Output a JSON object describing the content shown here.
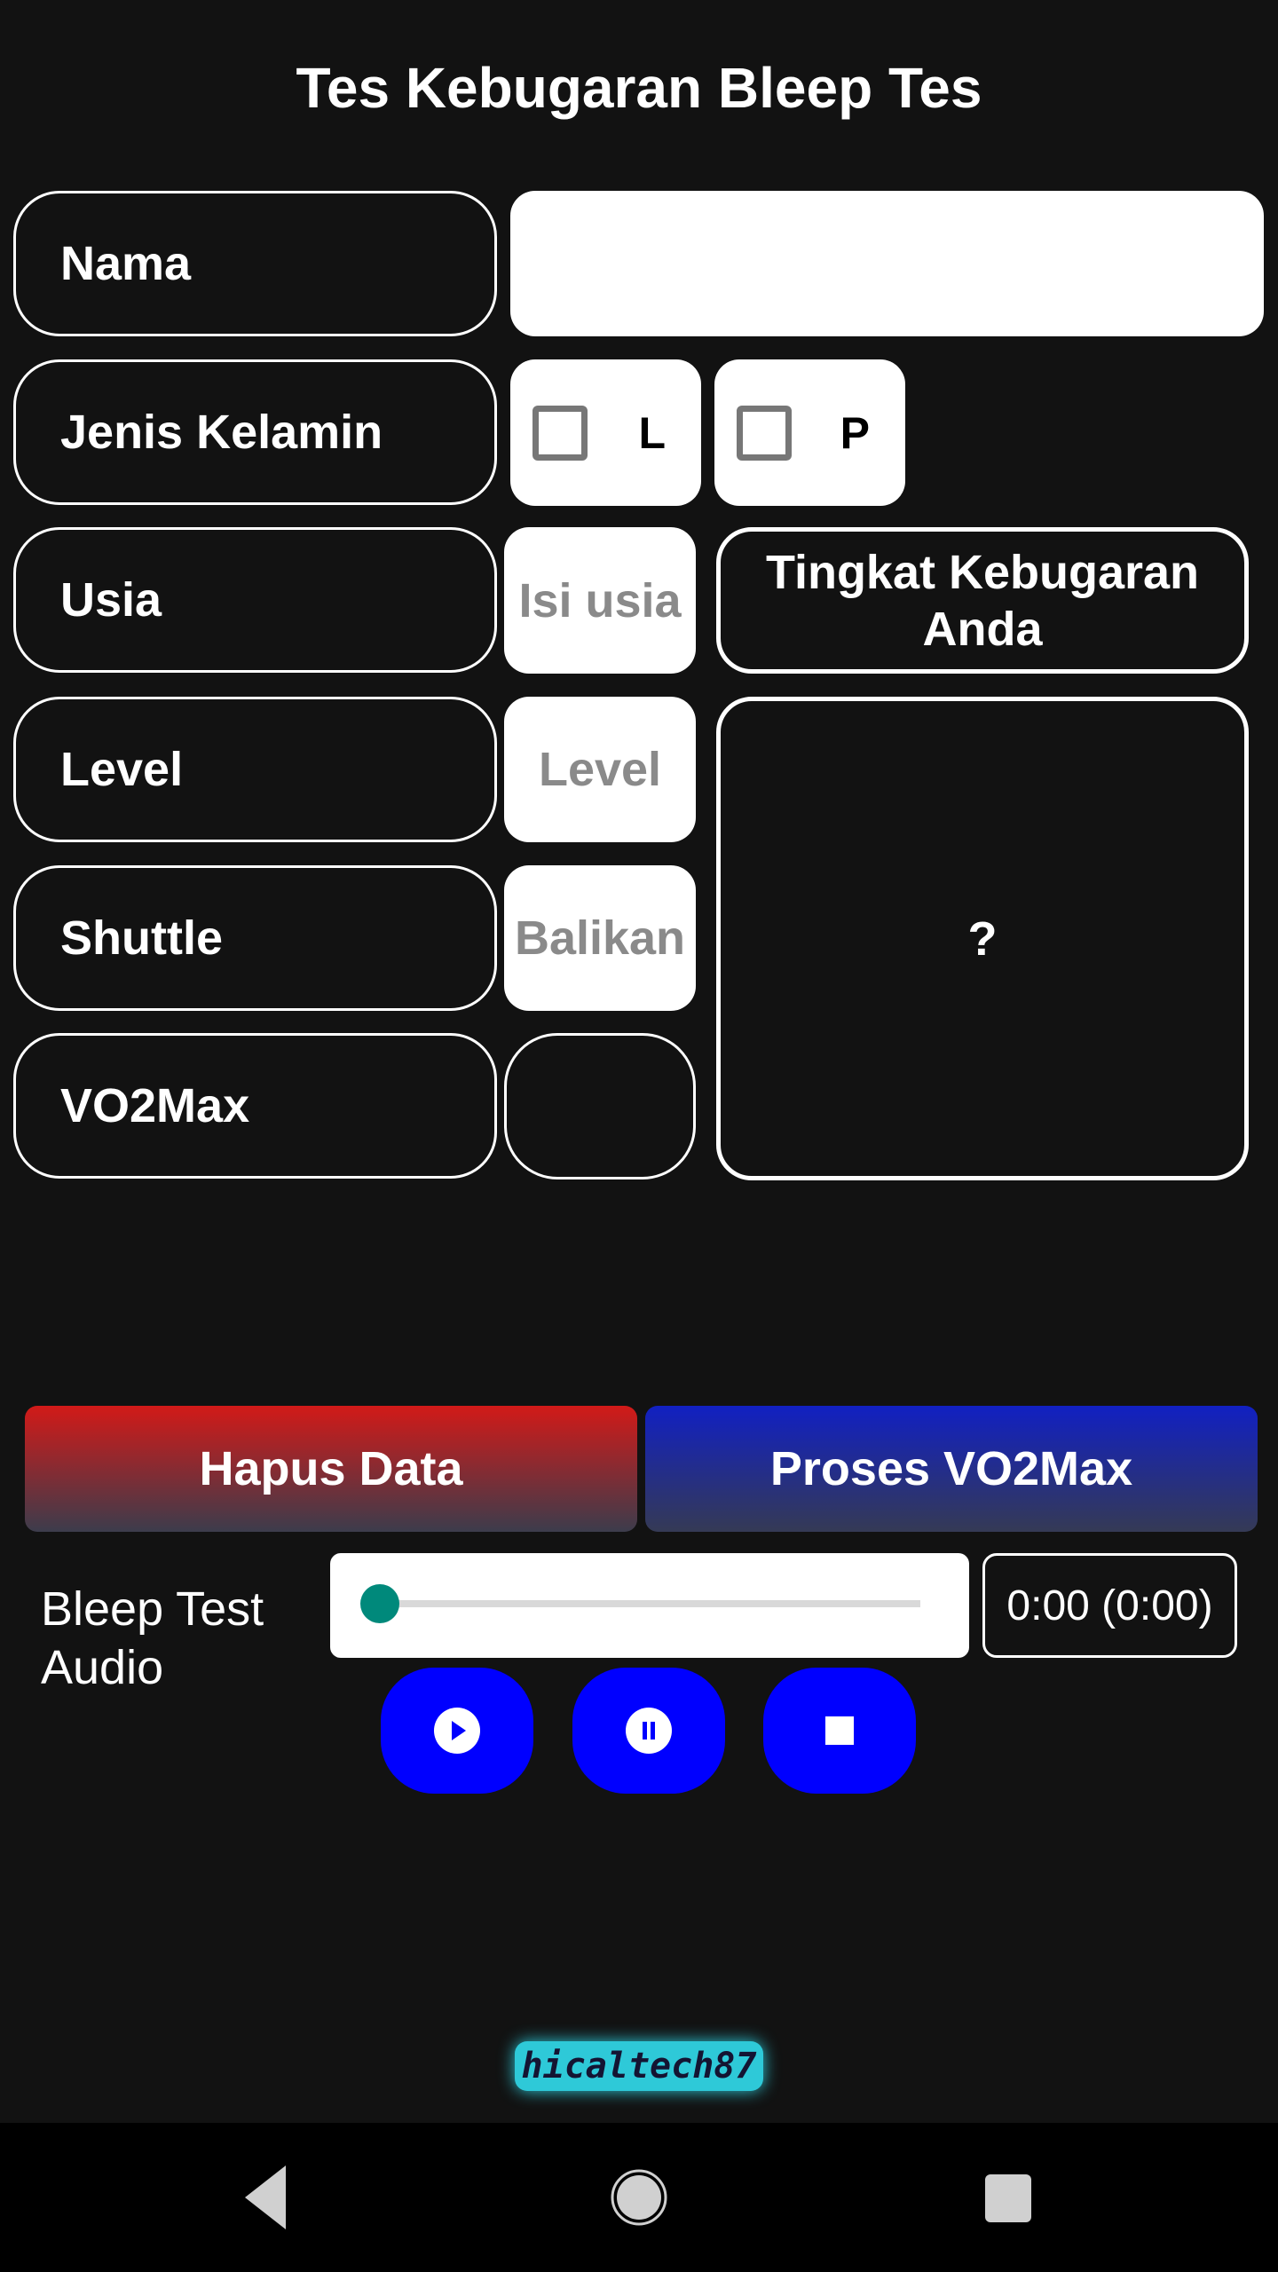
{
  "app": {
    "title": "Tes Kebugaran Bleep Tes"
  },
  "form": {
    "nama_label": "Nama",
    "nama_value": "",
    "gender_label": "Jenis Kelamin",
    "gender_options": [
      {
        "label": "L",
        "checked": false
      },
      {
        "label": "P",
        "checked": false
      }
    ],
    "usia_label": "Usia",
    "usia_placeholder": "Isi usia",
    "level_label": "Level",
    "level_placeholder": "Level",
    "shuttle_label": "Shuttle",
    "shuttle_placeholder": "Balikan",
    "vo2max_label": "VO2Max",
    "vo2max_value": ""
  },
  "result": {
    "title": "Tingkat Kebugaran Anda",
    "value": "?"
  },
  "actions": {
    "clear_label": "Hapus Data",
    "process_label": "Proses VO2Max"
  },
  "audio": {
    "label": "Bleep Test Audio",
    "time": "0:00 (0:00)",
    "progress": 0,
    "controls": [
      "play-icon",
      "pause-icon",
      "stop-icon"
    ]
  },
  "logo": {
    "text": "hicaltech87"
  },
  "colors": {
    "accent_blue": "#0000ff",
    "clear_red": "#d21a18",
    "process_blue": "#1120c2",
    "slider_thumb": "#00897b"
  }
}
